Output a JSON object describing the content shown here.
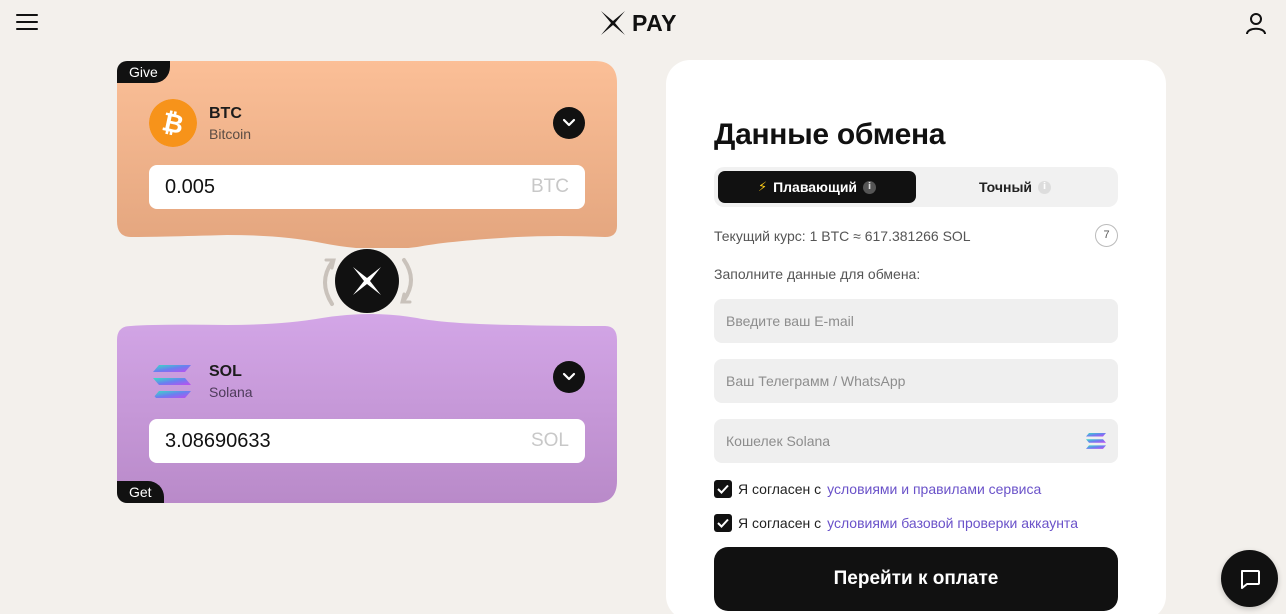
{
  "header": {
    "logo_text": "PAY",
    "menu_icon": "hamburger-icon",
    "user_icon": "user-icon"
  },
  "exchange": {
    "give": {
      "tag": "Give",
      "ticker": "BTC",
      "name": "Bitcoin",
      "amount": "0.005",
      "unit": "BTC",
      "icon": "bitcoin-icon",
      "color": "#f7931a"
    },
    "get": {
      "tag": "Get",
      "ticker": "SOL",
      "name": "Solana",
      "amount": "3.08690633",
      "unit": "SOL",
      "icon": "solana-icon"
    }
  },
  "panel": {
    "title": "Данные обмена",
    "toggle": {
      "floating": "Плавающий",
      "fixed": "Точный",
      "selected": "floating"
    },
    "rate_text": "Текущий курс: 1 BTC ≈ 617.381266 SOL",
    "timer": "7",
    "form_label": "Заполните данные для обмена:",
    "email_placeholder": "Введите ваш E-mail",
    "telegram_placeholder": "Ваш Телеграмм / WhatsApp",
    "wallet_placeholder": "Кошелек Solana",
    "agree_prefix": "Я согласен с",
    "agree_terms_link": "условиями и правилами сервиса",
    "agree_kyc_link": "условиями базовой проверки аккаунта",
    "submit_label": "Перейти к оплате"
  },
  "colors": {
    "accent": "#111111",
    "link": "#6a52c9",
    "give_card_top": "#fbbf97",
    "give_card_bottom": "#e3a57e",
    "get_card_top": "#d3a6e7",
    "get_card_bottom": "#b98ac9",
    "background": "#f3f0ec"
  }
}
